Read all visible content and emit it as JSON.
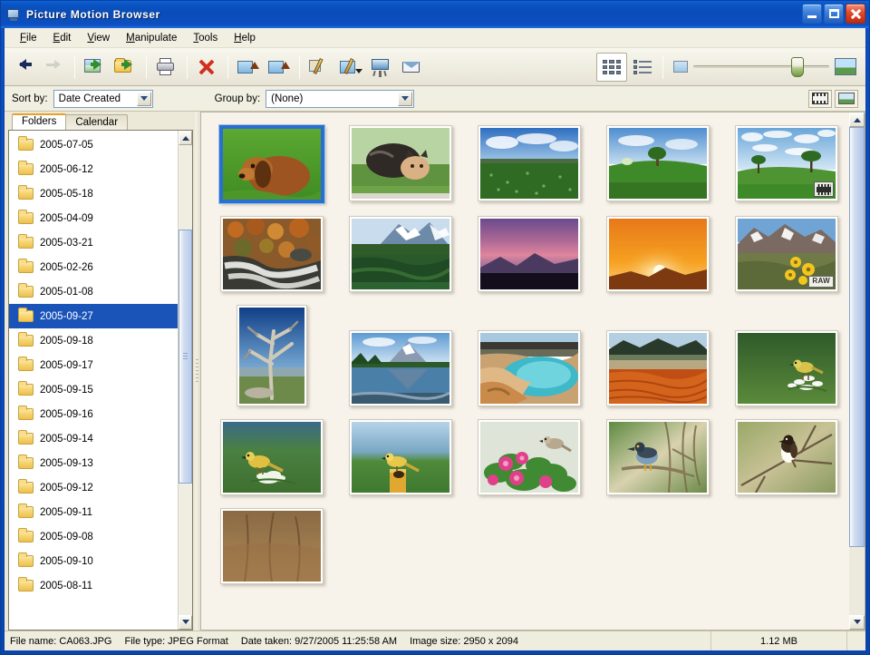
{
  "window": {
    "title": "Picture Motion Browser",
    "icon": "app-monitor-icon",
    "buttons": {
      "minimize": "Minimize",
      "maximize": "Maximize",
      "close": "Close"
    }
  },
  "menubar": {
    "items": [
      {
        "label": "File",
        "accel": "F"
      },
      {
        "label": "Edit",
        "accel": "E"
      },
      {
        "label": "View",
        "accel": "V"
      },
      {
        "label": "Manipulate",
        "accel": "M"
      },
      {
        "label": "Tools",
        "accel": "T"
      },
      {
        "label": "Help",
        "accel": "H"
      }
    ]
  },
  "toolbar": {
    "back": "Back",
    "forward": "Forward",
    "import_media": "Import Media",
    "import_folder": "Import Folder",
    "print": "Print",
    "delete": "Delete",
    "rotate_left": "Rotate Left",
    "rotate_right": "Rotate Right",
    "edit": "Edit Image",
    "adjust": "Adjust",
    "slideshow": "Slide Show",
    "email": "E-mail",
    "view_thumbnails": "Thumbnail View",
    "view_list": "List View",
    "zoom_small": "Small thumbnails",
    "zoom_large": "Large thumbnails",
    "zoom_value": 72
  },
  "sortbar": {
    "sort_label": "Sort by:",
    "sort_value": "Date Created",
    "group_label": "Group by:",
    "group_value": "(None)",
    "view_filmstrip": "Filmstrip View",
    "view_preview": "Preview View"
  },
  "sidebar": {
    "tabs": [
      {
        "label": "Folders",
        "active": true
      },
      {
        "label": "Calendar",
        "active": false
      }
    ],
    "folders": [
      {
        "label": "2005-07-05",
        "selected": false
      },
      {
        "label": "2005-06-12",
        "selected": false
      },
      {
        "label": "2005-05-18",
        "selected": false
      },
      {
        "label": "2005-04-09",
        "selected": false
      },
      {
        "label": "2005-03-21",
        "selected": false
      },
      {
        "label": "2005-02-26",
        "selected": false
      },
      {
        "label": "2005-01-08",
        "selected": false
      },
      {
        "label": "2005-09-27",
        "selected": true
      },
      {
        "label": "2005-09-18",
        "selected": false
      },
      {
        "label": "2005-09-17",
        "selected": false
      },
      {
        "label": "2005-09-15",
        "selected": false
      },
      {
        "label": "2005-09-16",
        "selected": false
      },
      {
        "label": "2005-09-14",
        "selected": false
      },
      {
        "label": "2005-09-13",
        "selected": false
      },
      {
        "label": "2005-09-12",
        "selected": false
      },
      {
        "label": "2005-09-11",
        "selected": false
      },
      {
        "label": "2005-09-08",
        "selected": false
      },
      {
        "label": "2005-09-10",
        "selected": false
      },
      {
        "label": "2005-08-11",
        "selected": false
      }
    ]
  },
  "thumbnails": {
    "rows": [
      [
        {
          "name": "dachshund-puppy-in-grass",
          "orient": "landscape",
          "selected": true,
          "badge": null
        },
        {
          "name": "tabby-cat-in-grass",
          "orient": "landscape",
          "selected": false,
          "badge": null
        },
        {
          "name": "green-meadow-under-clouds",
          "orient": "landscape",
          "selected": false,
          "badge": null
        },
        {
          "name": "green-hill-with-tree",
          "orient": "landscape",
          "selected": false,
          "badge": null
        },
        {
          "name": "lone-tree-on-hillside",
          "orient": "landscape",
          "selected": false,
          "badge": "video"
        }
      ],
      [
        {
          "name": "autumn-stream-rocks",
          "orient": "landscape",
          "selected": false,
          "badge": null
        },
        {
          "name": "snowy-peak-lake-reflection",
          "orient": "landscape",
          "selected": false,
          "badge": null
        },
        {
          "name": "purple-dusk-mountains",
          "orient": "landscape",
          "selected": false,
          "badge": null
        },
        {
          "name": "orange-sunset-over-ridge",
          "orient": "landscape",
          "selected": false,
          "badge": null
        },
        {
          "name": "mountain-with-yellow-flowers",
          "orient": "landscape",
          "selected": false,
          "badge": "raw"
        }
      ],
      [
        {
          "name": "weathered-dead-tree",
          "orient": "portrait",
          "selected": false,
          "badge": null
        },
        {
          "name": "teton-lake-reflection",
          "orient": "landscape",
          "selected": false,
          "badge": null
        },
        {
          "name": "thermal-spring-blue-pool",
          "orient": "landscape",
          "selected": false,
          "badge": null
        },
        {
          "name": "orange-thermal-basin",
          "orient": "landscape",
          "selected": false,
          "badge": null
        },
        {
          "name": "yellow-bird-on-white-flower",
          "orient": "landscape",
          "selected": false,
          "badge": null
        }
      ],
      [
        {
          "name": "yellow-wagtail-on-blossom",
          "orient": "landscape",
          "selected": false,
          "badge": null
        },
        {
          "name": "yellow-wagtail-on-post",
          "orient": "landscape",
          "selected": false,
          "badge": null
        },
        {
          "name": "bird-among-pink-flowers",
          "orient": "landscape",
          "selected": false,
          "badge": null
        },
        {
          "name": "night-heron-on-branch",
          "orient": "landscape",
          "selected": false,
          "badge": null
        },
        {
          "name": "stonechat-on-twig",
          "orient": "landscape",
          "selected": false,
          "badge": null
        }
      ],
      [
        {
          "name": "reeds-partial-row",
          "orient": "landscape",
          "selected": false,
          "badge": null
        }
      ]
    ],
    "badge_raw_label": "RAW"
  },
  "statusbar": {
    "file_name": "File name: CA063.JPG",
    "file_type": "File type: JPEG Format",
    "date_taken": "Date taken: 9/27/2005 11:25:58 AM",
    "image_size": "Image size: 2950 x 2094",
    "file_size": "1.12 MB"
  },
  "colors": {
    "titlebar_blue": "#0a4cb8",
    "selection_blue": "#1a54b8",
    "selected_thumb_border": "#2a6fd0",
    "pane_background": "#f7f2ea",
    "chrome_background": "#ece9d8",
    "active_tab_accent": "#e8a22c"
  }
}
